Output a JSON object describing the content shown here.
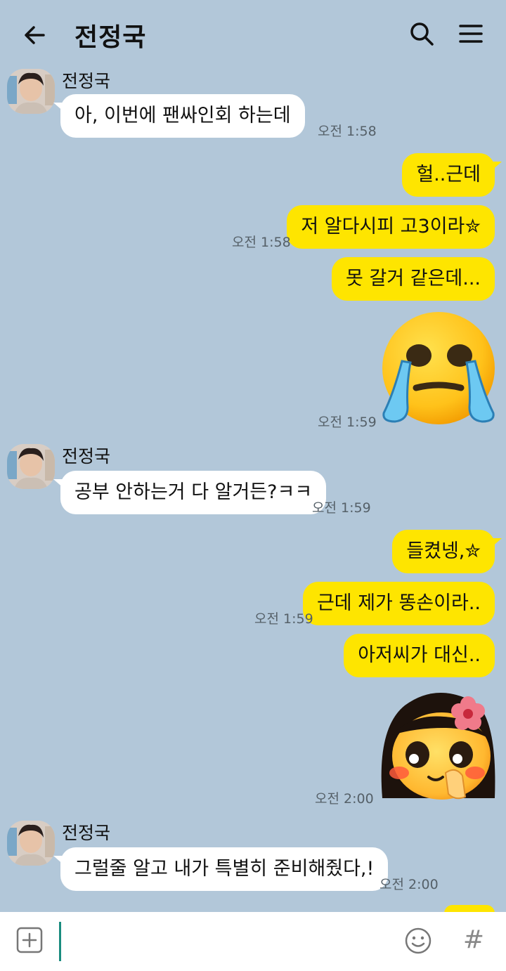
{
  "header": {
    "title": "전정국",
    "back_icon": "arrow-left-icon",
    "search_icon": "search-icon",
    "menu_icon": "hamburger-menu-icon"
  },
  "messages": [
    {
      "type": "in",
      "sender": "전정국",
      "text": "아, 이번에 팬싸인회 하는데",
      "time": "오전 1:58"
    },
    {
      "type": "out",
      "text": "헐..근데"
    },
    {
      "type": "out",
      "text": "저 알다시피 고3이라✮",
      "time": "오전 1:58"
    },
    {
      "type": "out",
      "text": "못 갈거 같은데..."
    },
    {
      "type": "out-emoticon",
      "emoticon": "crying-face-emoticon",
      "time": "오전 1:59"
    },
    {
      "type": "in",
      "sender": "전정국",
      "text": "공부 안하는거 다 알거든?ㅋㅋ",
      "time": "오전 1:59"
    },
    {
      "type": "out",
      "text": "들켰넹,✮"
    },
    {
      "type": "out",
      "text": "근데 제가 똥손이라..",
      "time": "오전 1:59"
    },
    {
      "type": "out",
      "text": "아저씨가 대신.."
    },
    {
      "type": "out-emoticon",
      "emoticon": "shy-girl-flower-emoticon",
      "time": "오전 2:00"
    },
    {
      "type": "in",
      "sender": "전정국",
      "text": "그럴줄 알고 내가 특별히 준비해줬다,!",
      "time": "오전 2:00"
    }
  ],
  "input_bar": {
    "placeholder": "",
    "plus_icon": "plus-square-icon",
    "emoji_icon": "smiley-icon",
    "hash_label": "#"
  },
  "colors": {
    "background": "#b2c7d9",
    "my_bubble": "#fee500",
    "their_bubble": "#ffffff",
    "cursor": "#1a8c7f"
  }
}
